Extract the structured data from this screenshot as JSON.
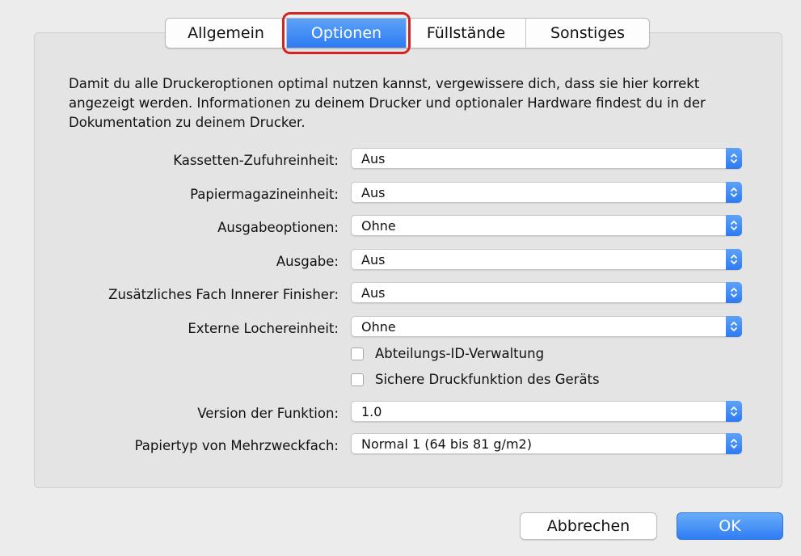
{
  "tabs": [
    {
      "label": "Allgemein",
      "active": false
    },
    {
      "label": "Optionen",
      "active": true
    },
    {
      "label": "Füllstände",
      "active": false
    },
    {
      "label": "Sonstiges",
      "active": false
    }
  ],
  "intro_text": "Damit du alle Druckeroptionen optimal nutzen kannst, vergewissere dich, dass sie hier korrekt angezeigt werden. Informationen zu deinem Drucker und optionaler Hardware findest du in der Dokumentation zu deinem Drucker.",
  "options": [
    {
      "label": "Kassetten-Zufuhreinheit:",
      "value": "Aus"
    },
    {
      "label": "Papiermagazineinheit:",
      "value": "Aus"
    },
    {
      "label": "Ausgabeoptionen:",
      "value": "Ohne"
    },
    {
      "label": "Ausgabe:",
      "value": "Aus"
    },
    {
      "label": "Zusätzliches Fach Innerer Finisher:",
      "value": "Aus"
    },
    {
      "label": "Externe Lochereinheit:",
      "value": "Ohne"
    }
  ],
  "checkboxes": [
    {
      "label": "Abteilungs-ID-Verwaltung",
      "checked": false
    },
    {
      "label": "Sichere Druckfunktion des Geräts",
      "checked": false
    }
  ],
  "options2": [
    {
      "label": "Version der Funktion:",
      "value": "1.0"
    },
    {
      "label": "Papiertyp von Mehrzweckfach:",
      "value": "Normal 1 (64 bis 81 g/m2)"
    }
  ],
  "buttons": {
    "cancel": "Abbrechen",
    "ok": "OK"
  },
  "colors": {
    "accent": "#2d7bf2",
    "highlight": "#d42320",
    "background": "#ececec"
  },
  "icons": {
    "select_arrow": "updown-chevron-icon"
  }
}
